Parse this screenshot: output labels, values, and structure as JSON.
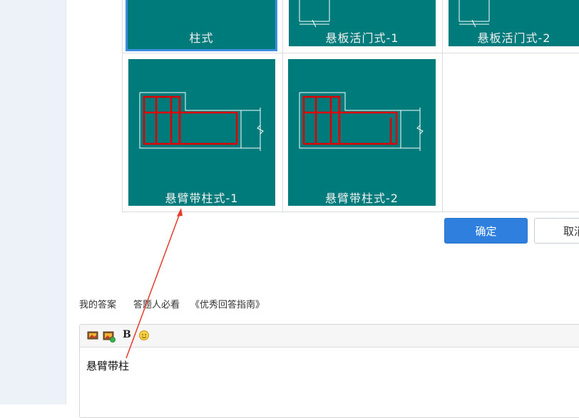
{
  "templates": [
    {
      "label": "柱式",
      "selected": true
    },
    {
      "label": "悬板活门式-1",
      "selected": false
    },
    {
      "label": "悬板活门式-2",
      "selected": false
    },
    {
      "label": "悬臂带柱式-1",
      "selected": false
    },
    {
      "label": "悬臂带柱式-2",
      "selected": false
    }
  ],
  "buttons": {
    "confirm": "确定",
    "cancel": "取消"
  },
  "answer_tabs": {
    "my_answer": "我的答案",
    "must_read": "答题人必看",
    "guide": "《优秀回答指南》"
  },
  "editor": {
    "toolbar_icons": [
      "image-icon",
      "multi-image-icon",
      "bold-icon",
      "emoji-icon"
    ],
    "bold_label": "B",
    "content": "悬臂带柱"
  },
  "colors": {
    "tile": "#007b7b",
    "drawing_red": "#e00000",
    "primary": "#2f7fdf",
    "arrow": "#e53b2c"
  }
}
